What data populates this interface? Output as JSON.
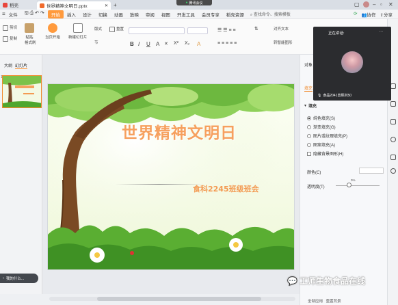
{
  "titlebar": {
    "home_tab": "稻壳",
    "file_tab": "世界精神文明日.pptx",
    "meeting_badge": "腾讯会议"
  },
  "ribbon_tabs": {
    "file": "文件",
    "items": [
      "开始",
      "插入",
      "设计",
      "切换",
      "动画",
      "放映",
      "审阅",
      "视图",
      "开发工具",
      "会员专享",
      "稻壳资源"
    ],
    "search_placeholder": "查找命令、搜索模板",
    "collab": "协作",
    "share": "分享"
  },
  "ribbon": {
    "cut": "剪切",
    "copy": "复制",
    "paste": "粘贴",
    "format_painter": "格式刷",
    "play_from_current": "当页开始",
    "new_slide": "新建幻灯片",
    "layout": "版式",
    "section": "节",
    "reset": "重置",
    "text_box": "文本框",
    "shape": "形状",
    "arrange": "排列",
    "align_text": "对齐文本",
    "convert_smartart": "转智能图形",
    "outline": "轮廓"
  },
  "left_pane": {
    "tab_outline": "大纲",
    "tab_slides": "幻灯片",
    "slide_number": "1",
    "assistant_text": "我的什么..."
  },
  "slide": {
    "title": "世界精神文明日",
    "subtitle": "食科2245班级班会"
  },
  "video": {
    "speaking_label": "正在讲话:",
    "caption": "食品2041曾熙刘50"
  },
  "right_panel": {
    "header": "对象",
    "tab_fill": "填充",
    "section_fill": "填充",
    "options": [
      "纯色填充(S)",
      "渐变填充(G)",
      "图片或纹理填充(P)",
      "图案填充(A)"
    ],
    "hide_bg": "隐藏背景图形(H)",
    "color_label": "颜色(C)",
    "transparency_label": "透明度(T)",
    "transparency_value": "0%",
    "bottom_apply_all": "全部应用",
    "bottom_reset": "重置背景"
  },
  "watermark": "工师生物食品在线",
  "colors": {
    "accent": "#ff9a3d",
    "slide_title": "#f6a05e"
  }
}
